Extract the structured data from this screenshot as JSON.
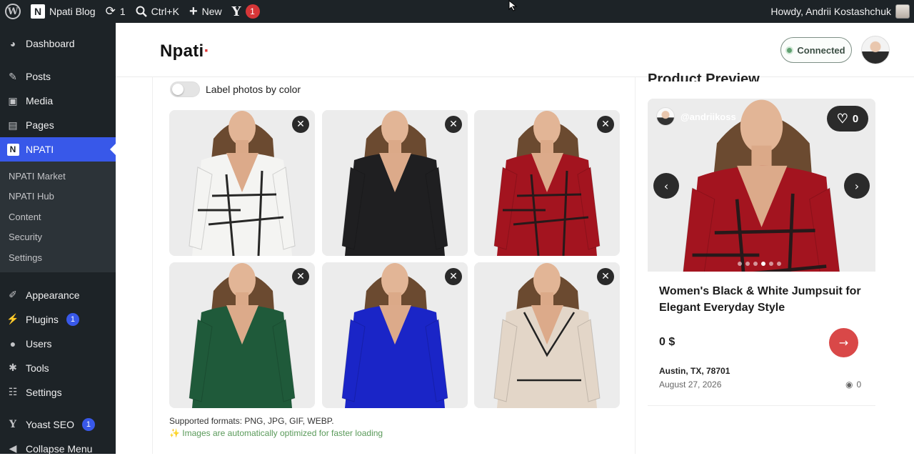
{
  "adminbar": {
    "site_name": "Npati Blog",
    "updates_count": "1",
    "search_shortcut": "Ctrl+K",
    "new_label": "New",
    "yoast_count": "1",
    "howdy": "Howdy, Andrii Kostashchuk"
  },
  "sidebar": {
    "items": [
      {
        "label": "Dashboard",
        "icon": "dashboard-icon"
      },
      {
        "label": "Posts",
        "icon": "pin-icon"
      },
      {
        "label": "Media",
        "icon": "media-icon"
      },
      {
        "label": "Pages",
        "icon": "pages-icon"
      },
      {
        "label": "NPATI",
        "icon": "npati-logo-icon"
      }
    ],
    "submenu": [
      "NPATI Market",
      "NPATI Hub",
      "Content",
      "Security",
      "Settings"
    ],
    "lower": [
      {
        "label": "Appearance",
        "icon": "brush-icon"
      },
      {
        "label": "Plugins",
        "icon": "plug-icon",
        "badge": "1"
      },
      {
        "label": "Users",
        "icon": "user-icon"
      },
      {
        "label": "Tools",
        "icon": "wrench-icon"
      },
      {
        "label": "Settings",
        "icon": "sliders-icon"
      },
      {
        "label": "Yoast SEO",
        "icon": "yoast-icon",
        "badge": "1"
      },
      {
        "label": "Collapse Menu",
        "icon": "collapse-icon"
      }
    ]
  },
  "header": {
    "brand": "Npati",
    "connected": "Connected"
  },
  "uploader": {
    "toggle_label": "Label photos by color",
    "photos": [
      {
        "color": "white",
        "alt": "white jumpsuit"
      },
      {
        "color": "black",
        "alt": "black jumpsuit"
      },
      {
        "color": "red",
        "alt": "red jumpsuit"
      },
      {
        "color": "green",
        "alt": "green jumpsuit"
      },
      {
        "color": "blue",
        "alt": "blue jumpsuit"
      },
      {
        "color": "beige",
        "alt": "beige jumpsuit"
      }
    ],
    "formats": "Supported formats: PNG, JPG, GIF, WEBP.",
    "optimized": "✨ Images are automatically optimized for faster loading"
  },
  "preview": {
    "title": "Product Preview",
    "author": "@andriikoss",
    "likes": "0",
    "product_title": "Women's Black & White Jumpsuit for Elegant Everyday Style",
    "price": "0 $",
    "location": "Austin, TX, 78701",
    "date": "August 27, 2026",
    "views": "0",
    "slides": 6,
    "active_slide": 3
  },
  "colors": {
    "adminbar_bg": "#1d2327",
    "accent": "#3858e9",
    "cta": "#d94848"
  }
}
